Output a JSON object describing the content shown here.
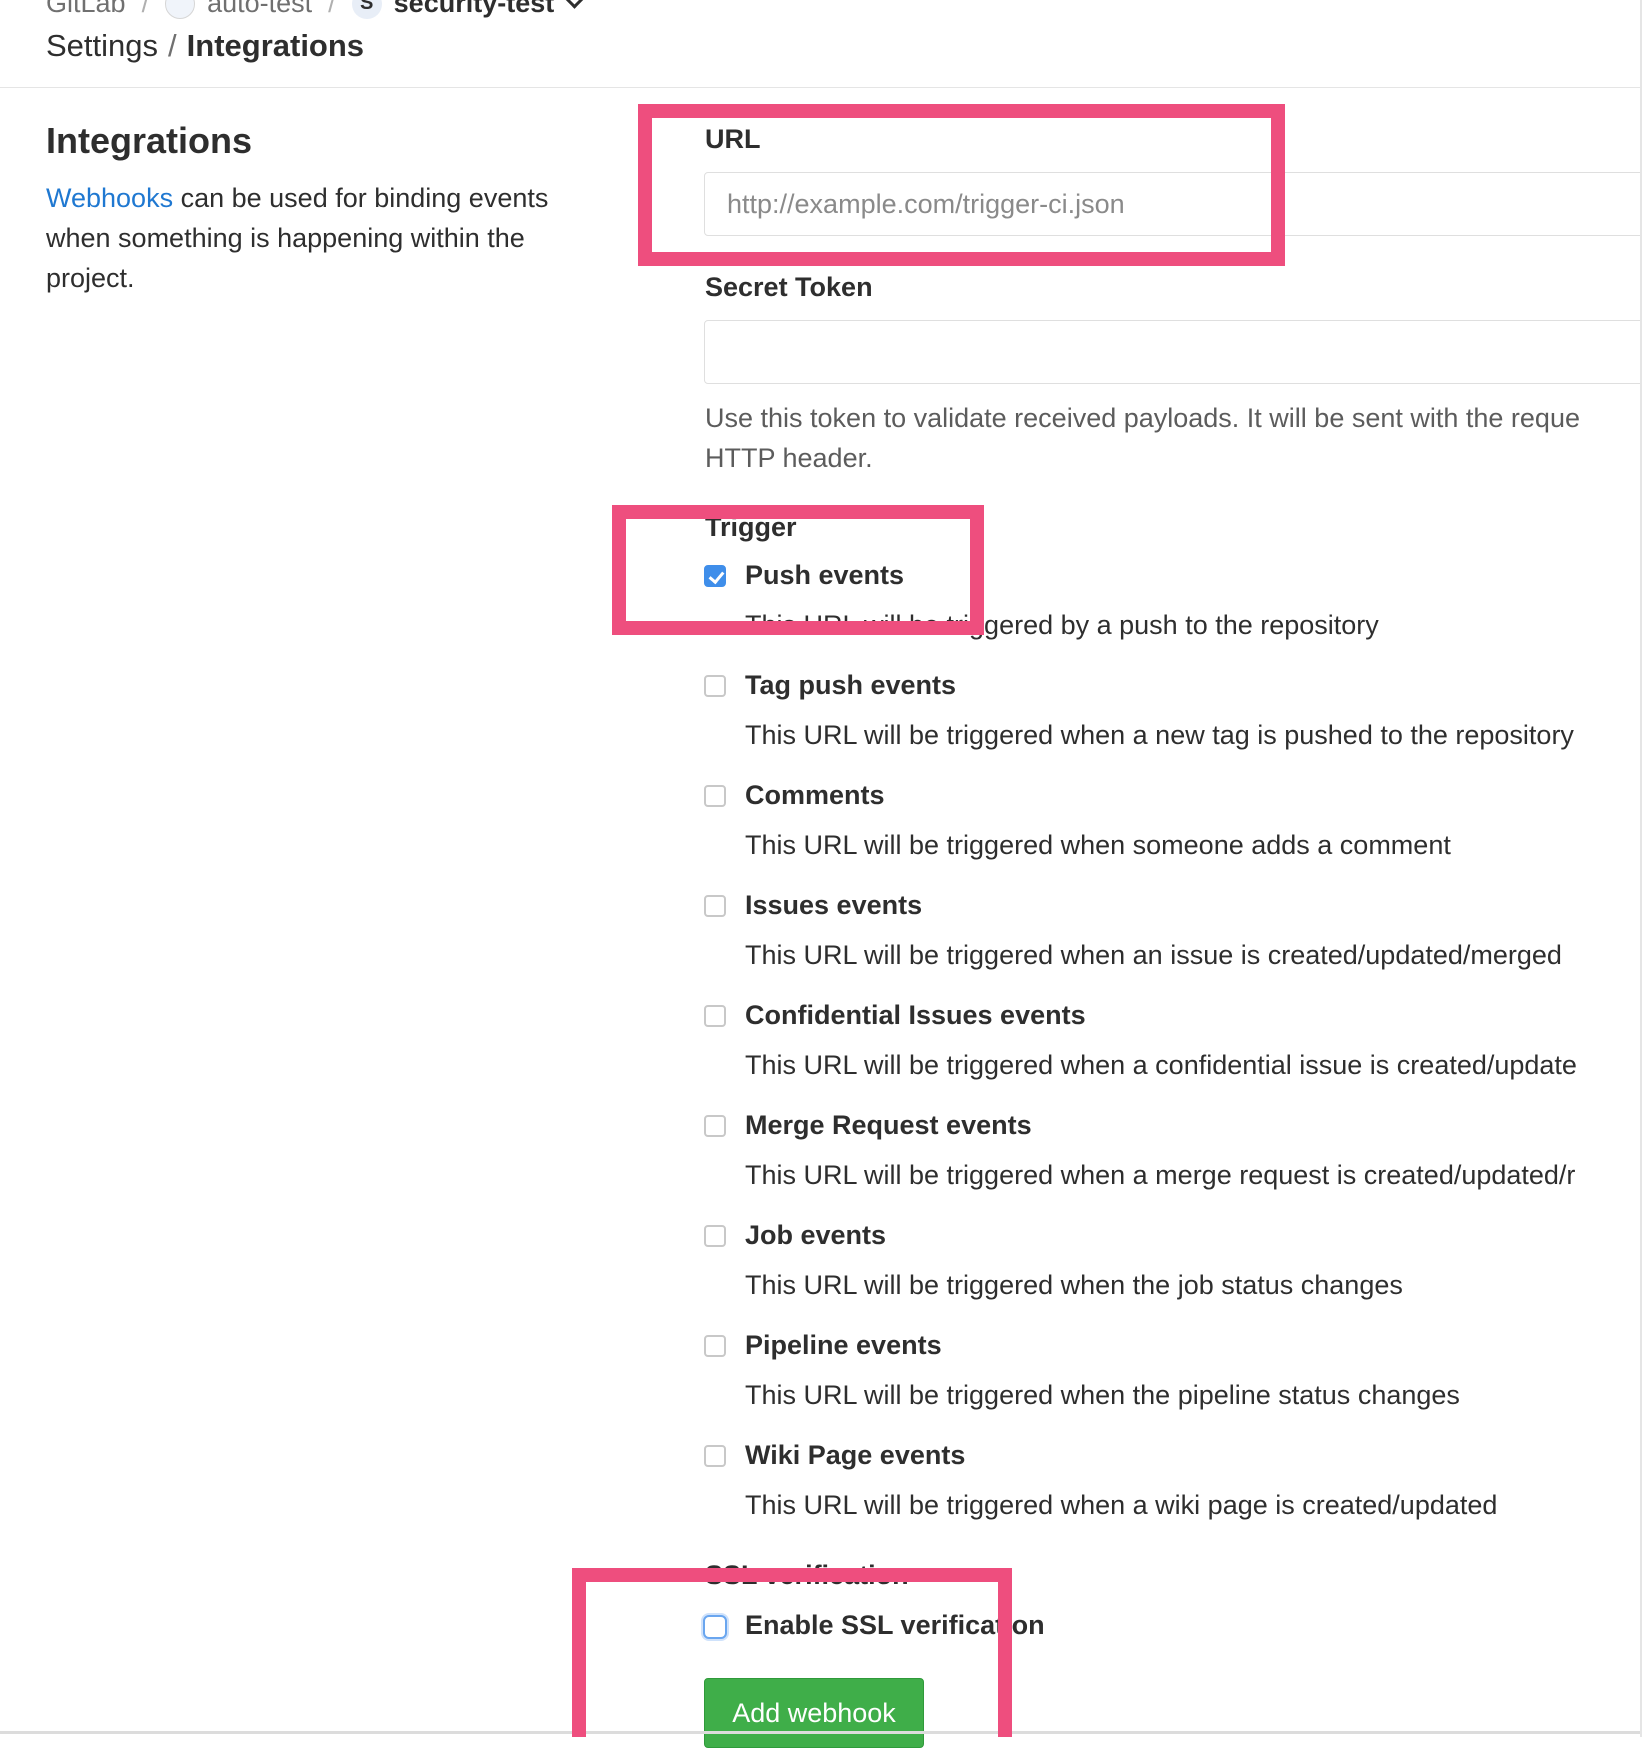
{
  "breadcrumb": {
    "root": "GitLab",
    "separator": "/",
    "group": "auto-test",
    "project_initial": "S",
    "project": "security-test"
  },
  "title": {
    "parent": "Settings",
    "separator": "/",
    "current": "Integrations"
  },
  "sidebar": {
    "heading": "Integrations",
    "link": "Webhooks",
    "description": "can be used for binding events when something is happening within the project."
  },
  "form": {
    "url_label": "URL",
    "url_placeholder": "http://example.com/trigger-ci.json",
    "secret_label": "Secret Token",
    "secret_value": "",
    "secret_help_line1": "Use this token to validate received payloads. It will be sent with the reque",
    "secret_help_line2": "HTTP header.",
    "trigger_label": "Trigger",
    "events": [
      {
        "label": "Push events",
        "checked": true,
        "desc": "This URL will be triggered by a push to the repository"
      },
      {
        "label": "Tag push events",
        "checked": false,
        "desc": "This URL will be triggered when a new tag is pushed to the repository"
      },
      {
        "label": "Comments",
        "checked": false,
        "desc": "This URL will be triggered when someone adds a comment"
      },
      {
        "label": "Issues events",
        "checked": false,
        "desc": "This URL will be triggered when an issue is created/updated/merged"
      },
      {
        "label": "Confidential Issues events",
        "checked": false,
        "desc": "This URL will be triggered when a confidential issue is created/update"
      },
      {
        "label": "Merge Request events",
        "checked": false,
        "desc": "This URL will be triggered when a merge request is created/updated/r"
      },
      {
        "label": "Job events",
        "checked": false,
        "desc": "This URL will be triggered when the job status changes"
      },
      {
        "label": "Pipeline events",
        "checked": false,
        "desc": "This URL will be triggered when the pipeline status changes"
      },
      {
        "label": "Wiki Page events",
        "checked": false,
        "desc": "This URL will be triggered when a wiki page is created/updated"
      }
    ],
    "ssl_label": "SSL verification",
    "ssl_checkbox_label": "Enable SSL verification",
    "ssl_checked": false,
    "submit_label": "Add webhook"
  },
  "colors": {
    "highlight": "#ee4e7e",
    "link": "#1f78d1",
    "primary_button": "#3fae49",
    "checkbox_checked": "#3f8eea"
  }
}
